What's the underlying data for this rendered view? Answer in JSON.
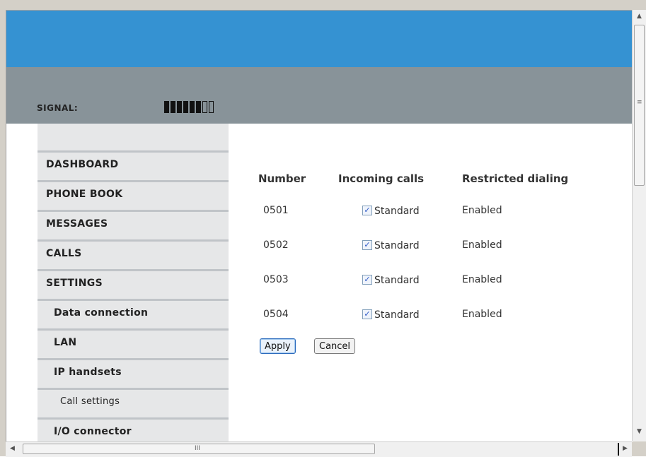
{
  "header": {
    "signal_label": "SIGNAL:",
    "signal_level": 6,
    "signal_max": 8
  },
  "sidebar": {
    "items": [
      {
        "label": "DASHBOARD",
        "level": 0
      },
      {
        "label": "PHONE BOOK",
        "level": 0
      },
      {
        "label": "MESSAGES",
        "level": 0
      },
      {
        "label": "CALLS",
        "level": 0
      },
      {
        "label": "SETTINGS",
        "level": 0
      },
      {
        "label": "Data connection",
        "level": 1
      },
      {
        "label": "LAN",
        "level": 1
      },
      {
        "label": "IP handsets",
        "level": 1
      },
      {
        "label": "Call settings",
        "level": 2
      },
      {
        "label": "I/O connector",
        "level": 1
      }
    ]
  },
  "table": {
    "headers": {
      "number": "Number",
      "incoming": "Incoming calls",
      "restricted": "Restricted dialing"
    },
    "rows": [
      {
        "number": "0501",
        "checked": true,
        "incoming": "Standard",
        "restricted": "Enabled"
      },
      {
        "number": "0502",
        "checked": true,
        "incoming": "Standard",
        "restricted": "Enabled"
      },
      {
        "number": "0503",
        "checked": true,
        "incoming": "Standard",
        "restricted": "Enabled"
      },
      {
        "number": "0504",
        "checked": true,
        "incoming": "Standard",
        "restricted": "Enabled"
      }
    ]
  },
  "buttons": {
    "apply": "Apply",
    "cancel": "Cancel"
  },
  "icons": {
    "checkbox_checked": "✓",
    "scroll_grip_h": "III",
    "scroll_grip_v": "≡",
    "arrow_up": "▲",
    "arrow_down": "▼",
    "arrow_left": "◀",
    "arrow_right": "▶"
  },
  "colors": {
    "header_blue": "#3592d2",
    "signal_gray": "#889399",
    "sidebar_bg": "#e6e7e8"
  }
}
